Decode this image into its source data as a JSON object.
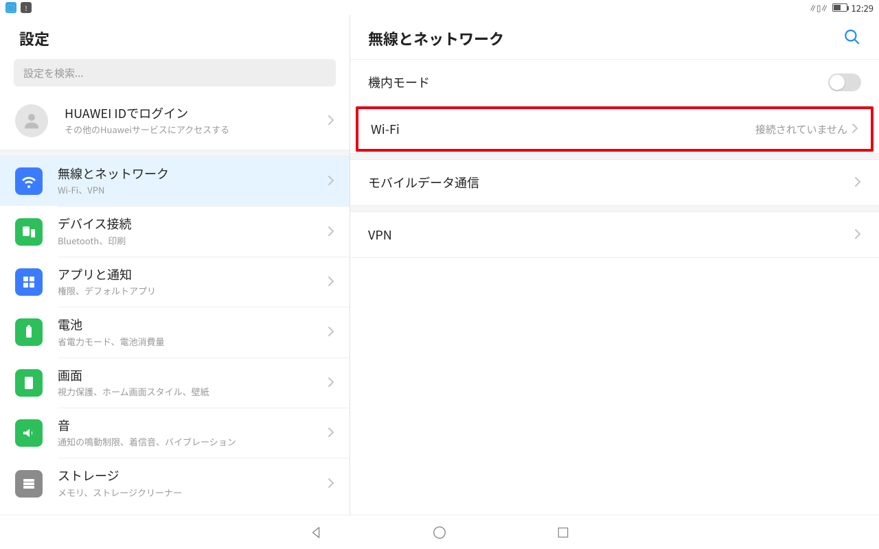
{
  "statusbar": {
    "time": "12:29"
  },
  "sidebar": {
    "title": "設定",
    "search_placeholder": "設定を検索...",
    "login": {
      "title": "HUAWEI IDでログイン",
      "sub": "その他のHuaweiサービスにアクセスする"
    },
    "items": [
      {
        "title": "無線とネットワーク",
        "sub": "Wi-Fi、VPN"
      },
      {
        "title": "デバイス接続",
        "sub": "Bluetooth、印刷"
      },
      {
        "title": "アプリと通知",
        "sub": "権限、デフォルトアプリ"
      },
      {
        "title": "電池",
        "sub": "省電力モード、電池消費量"
      },
      {
        "title": "画面",
        "sub": "視力保護、ホーム画面スタイル、壁紙"
      },
      {
        "title": "音",
        "sub": "通知の鳴動制限、着信音、バイブレーション"
      },
      {
        "title": "ストレージ",
        "sub": "メモリ、ストレージクリーナー"
      }
    ]
  },
  "main": {
    "title": "無線とネットワーク",
    "airplane": "機内モード",
    "wifi": {
      "label": "Wi-Fi",
      "value": "接続されていません"
    },
    "mobile": "モバイルデータ通信",
    "vpn": "VPN"
  }
}
